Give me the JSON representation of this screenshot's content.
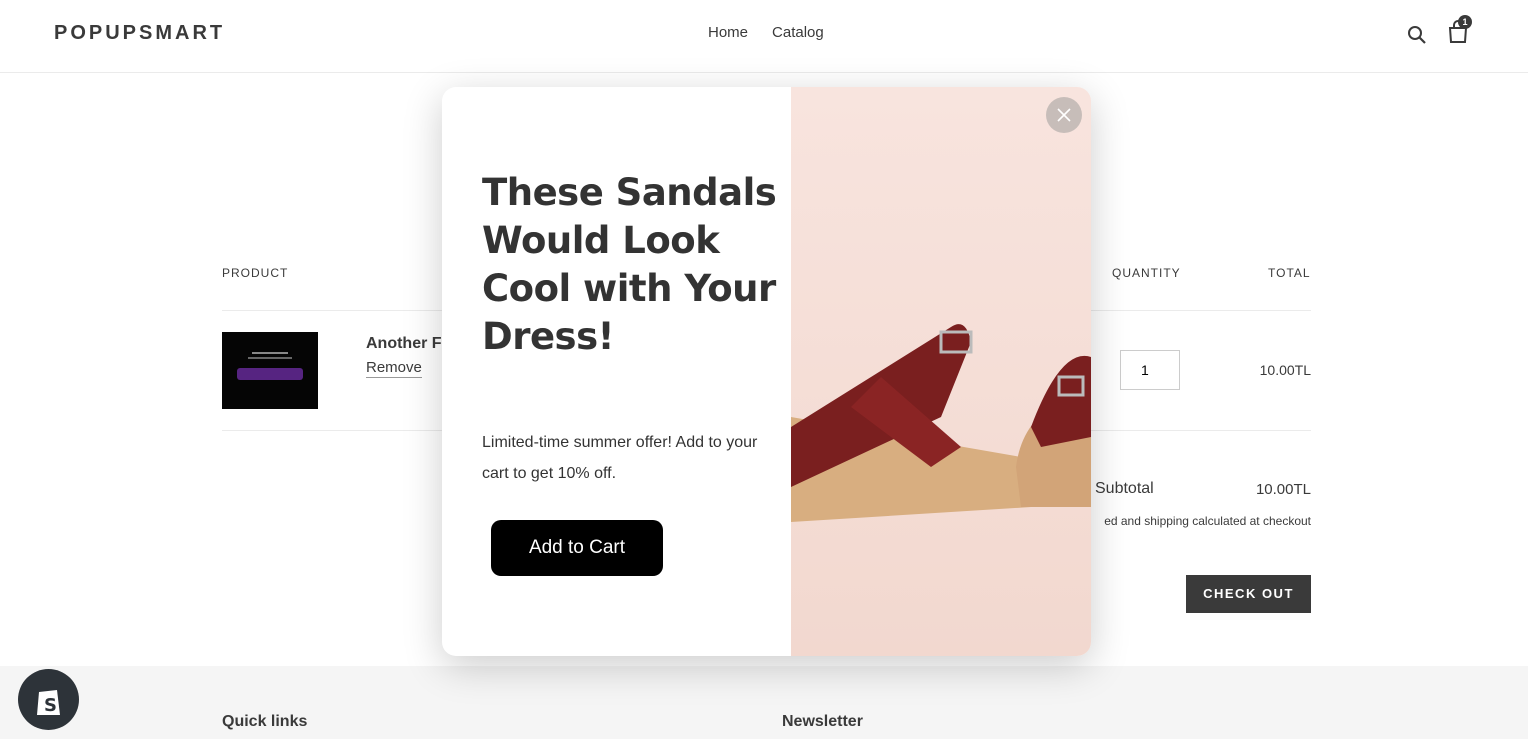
{
  "header": {
    "logo": "POPUPSMART",
    "nav": [
      "Home",
      "Catalog"
    ],
    "cart_count": "1"
  },
  "cart": {
    "headers": {
      "product": "PRODUCT",
      "quantity": "QUANTITY",
      "total": "TOTAL"
    },
    "item": {
      "name": "Another F",
      "remove": "Remove",
      "quantity": "1",
      "total": "10.00TL"
    },
    "subtotal_label": "Subtotal",
    "subtotal_value": "10.00TL",
    "taxes_note": "ed and shipping calculated at checkout",
    "checkout": "CHECK OUT"
  },
  "footer": {
    "quick_links": "Quick links",
    "newsletter": "Newsletter"
  },
  "popup": {
    "title": "These Sandals Would Look Cool with Your Dress!",
    "description": "Limited-time summer offer! Add to your cart to get 10% off.",
    "button": "Add to Cart"
  }
}
